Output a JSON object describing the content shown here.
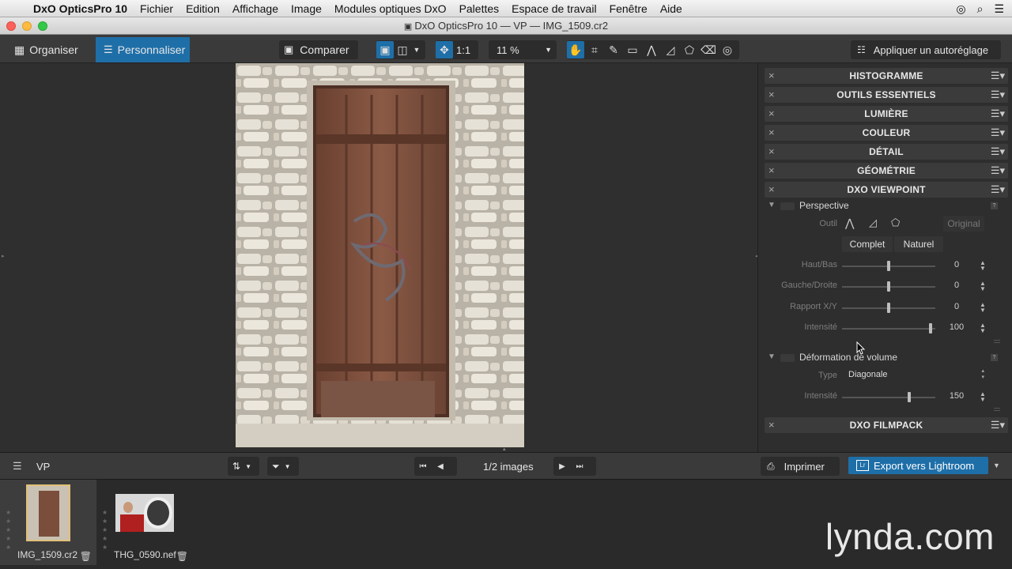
{
  "menubar": {
    "app": "DxO OpticsPro 10",
    "items": [
      "Fichier",
      "Edition",
      "Affichage",
      "Image",
      "Modules optiques DxO",
      "Palettes",
      "Espace de travail",
      "Fenêtre",
      "Aide"
    ]
  },
  "window": {
    "title": "DxO OpticsPro 10 — VP — IMG_1509.cr2"
  },
  "toolbar": {
    "organiser": "Organiser",
    "personnaliser": "Personnaliser",
    "comparer": "Comparer",
    "ratio": "1:1",
    "zoom": "11 %",
    "auto": "Appliquer un autoréglage"
  },
  "panel": {
    "sections": [
      "HISTOGRAMME",
      "OUTILS ESSENTIELS",
      "LUMIÈRE",
      "COULEUR",
      "DÉTAIL",
      "GÉOMÉTRIE",
      "DXO VIEWPOINT"
    ],
    "filmpack": "DXO FILMPACK",
    "perspective": {
      "title": "Perspective",
      "outil_label": "Outil",
      "original": "Original",
      "complet": "Complet",
      "naturel": "Naturel",
      "sliders": [
        {
          "label": "Haut/Bas",
          "value": "0",
          "fraction": 0.5
        },
        {
          "label": "Gauche/Droite",
          "value": "0",
          "fraction": 0.5
        },
        {
          "label": "Rapport X/Y",
          "value": "0",
          "fraction": 0.5
        },
        {
          "label": "Intensité",
          "value": "100",
          "fraction": 1.0
        }
      ]
    },
    "volume": {
      "title": "Déformation de volume",
      "type_label": "Type",
      "type_value": "Diagonale",
      "intensity_label": "Intensité",
      "intensity_value": "150",
      "intensity_fraction": 0.75
    }
  },
  "bottombar": {
    "project": "VP",
    "count": "1/2 images",
    "print": "Imprimer",
    "export": "Export vers Lightroom"
  },
  "filmstrip": [
    {
      "name": "IMG_1509.cr2"
    },
    {
      "name": "THG_0590.nef"
    }
  ],
  "watermark": "lynda.com"
}
